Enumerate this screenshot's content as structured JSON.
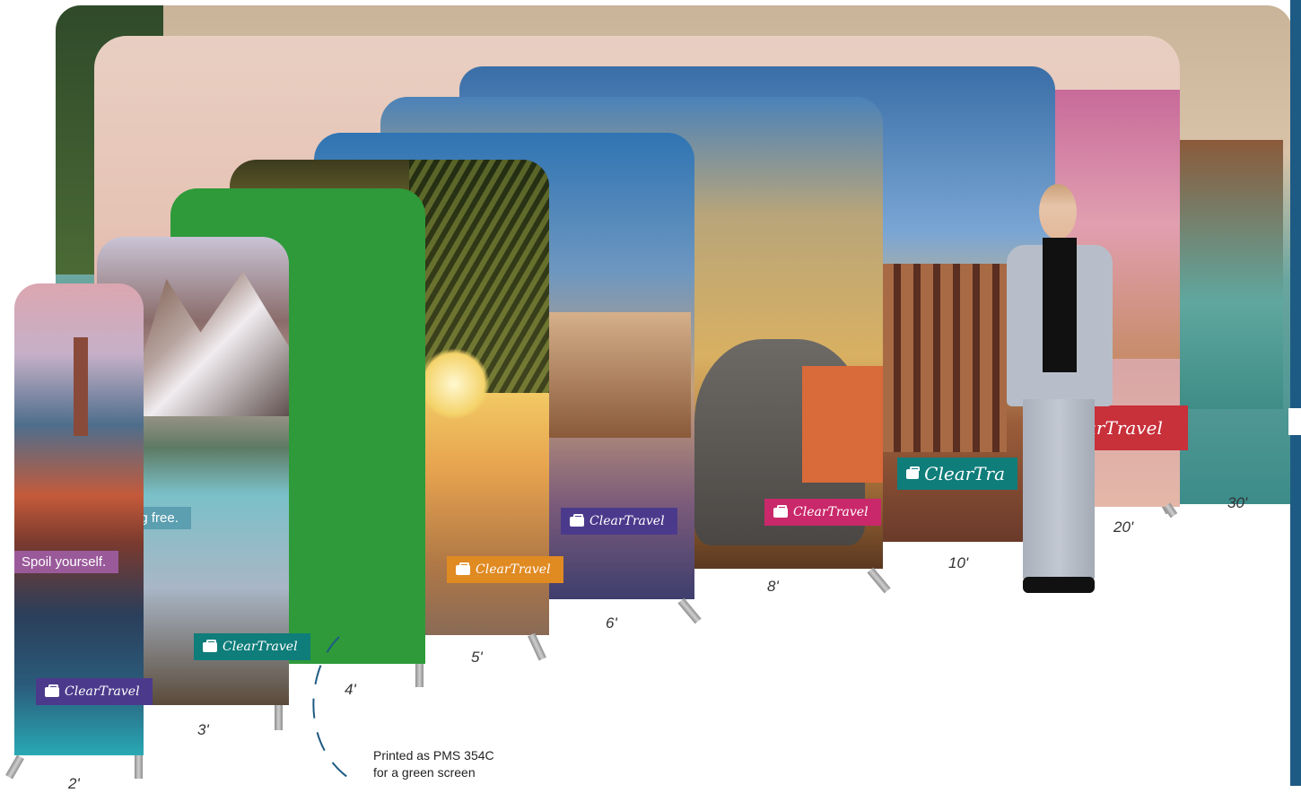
{
  "sizes": {
    "s30": "30'",
    "s20": "20'",
    "s10": "10'",
    "s8": "8'",
    "s6": "6'",
    "s5": "5'",
    "s4": "4'",
    "s3": "3'",
    "s2": "2'"
  },
  "brand": {
    "name": "ClearTravel",
    "partial_10": "ClearTra",
    "partial_20": "arTravel"
  },
  "taglines": {
    "spoil": "Spoil yourself.",
    "free": "ng free."
  },
  "note": {
    "line1": "Printed as PMS 354C",
    "line2": "for a green screen"
  },
  "colors": {
    "green_screen": "#2e9a3a",
    "accent_blue": "#1e5b84",
    "brand_purple": "#4b3a8c",
    "brand_pink": "#c9286a",
    "brand_orange": "#e08a22",
    "brand_teal": "#0f7d7a",
    "brand_red": "#c8303a"
  }
}
